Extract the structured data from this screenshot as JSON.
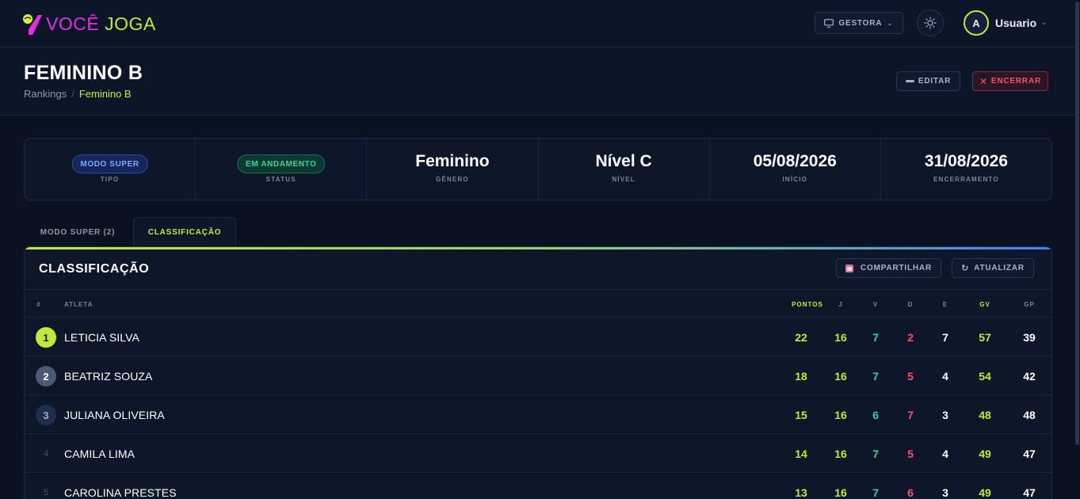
{
  "brand": {
    "part1": "VOCÊ",
    "part2": "JOGA"
  },
  "topbar": {
    "profile_label": "GESTORA",
    "avatar_initial": "A",
    "username": "Usuario"
  },
  "header": {
    "title": "FEMININO B",
    "breadcrumb_root": "Rankings",
    "breadcrumb_current": "Feminino B",
    "edit_label": "EDITAR",
    "close_label": "ENCERRAR"
  },
  "info": [
    {
      "pill": "MODO SUPER",
      "label": "TIPO"
    },
    {
      "pill": "EM ANDAMENTO",
      "label": "STATUS"
    },
    {
      "value": "Feminino",
      "label": "GÊNERO"
    },
    {
      "value": "Nível C",
      "label": "NÍVEL"
    },
    {
      "value": "05/08/2026",
      "label": "INÍCIO"
    },
    {
      "value": "31/08/2026",
      "label": "ENCERRAMENTO"
    }
  ],
  "tabs": [
    {
      "label": "MODO SUPER (2)"
    },
    {
      "label": "CLASSIFICAÇÃO"
    }
  ],
  "panel": {
    "title": "CLASSIFICAÇÃO",
    "share_label": "COMPARTILHAR",
    "refresh_label": "ATUALIZAR"
  },
  "table": {
    "headers": {
      "rank": "#",
      "athlete": "ATLETA",
      "pts": "PONTOS",
      "j": "J",
      "v": "V",
      "d": "D",
      "e": "E",
      "gv": "GV",
      "gp": "GP"
    },
    "rows": [
      {
        "rank": "1",
        "name": "LETICIA SILVA",
        "pts": "22",
        "j": "16",
        "v": "7",
        "d": "2",
        "e": "7",
        "gv": "57",
        "gp": "39"
      },
      {
        "rank": "2",
        "name": "BEATRIZ SOUZA",
        "pts": "18",
        "j": "16",
        "v": "7",
        "d": "5",
        "e": "4",
        "gv": "54",
        "gp": "42"
      },
      {
        "rank": "3",
        "name": "JULIANA OLIVEIRA",
        "pts": "15",
        "j": "16",
        "v": "6",
        "d": "7",
        "e": "3",
        "gv": "48",
        "gp": "48"
      },
      {
        "rank": "4",
        "name": "CAMILA LIMA",
        "pts": "14",
        "j": "16",
        "v": "7",
        "d": "5",
        "e": "4",
        "gv": "49",
        "gp": "47"
      },
      {
        "rank": "5",
        "name": "CAROLINA PRESTES",
        "pts": "13",
        "j": "16",
        "v": "7",
        "d": "6",
        "e": "3",
        "gv": "49",
        "gp": "47"
      }
    ]
  },
  "colors": {
    "accent": "#c4e83a",
    "brand_magenta": "#e62ee0",
    "danger": "#ff4f6a",
    "success": "#34d399"
  }
}
